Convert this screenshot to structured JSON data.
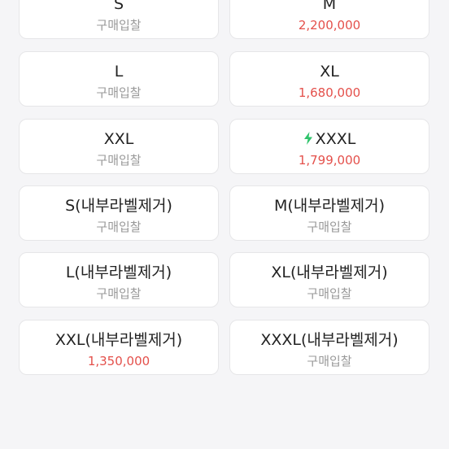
{
  "colors": {
    "page_background": "#f5f5f7",
    "card_background": "#ffffff",
    "card_border": "#e6e6e8",
    "size_text": "#222222",
    "placeholder_text": "#999999",
    "price_text": "#e4504b",
    "bolt_icon": "#2fc36b"
  },
  "cards": [
    {
      "size": "S",
      "value": "구매입찰",
      "has_price": false
    },
    {
      "size": "M",
      "value": "2,200,000",
      "has_price": true
    },
    {
      "size": "L",
      "value": "구매입찰",
      "has_price": false
    },
    {
      "size": "XL",
      "value": "1,680,000",
      "has_price": true
    },
    {
      "size": "XXL",
      "value": "구매입찰",
      "has_price": false
    },
    {
      "size": "XXXL",
      "value": "1,799,000",
      "has_price": true,
      "icon": "lightning-bolt-icon"
    },
    {
      "size": "S(내부라벨제거)",
      "value": "구매입찰",
      "has_price": false
    },
    {
      "size": "M(내부라벨제거)",
      "value": "구매입찰",
      "has_price": false
    },
    {
      "size": "L(내부라벨제거)",
      "value": "구매입찰",
      "has_price": false
    },
    {
      "size": "XL(내부라벨제거)",
      "value": "구매입찰",
      "has_price": false
    },
    {
      "size": "XXL(내부라벨제거)",
      "value": "1,350,000",
      "has_price": true
    },
    {
      "size": "XXXL(내부라벨제거)",
      "value": "구매입찰",
      "has_price": false
    }
  ]
}
